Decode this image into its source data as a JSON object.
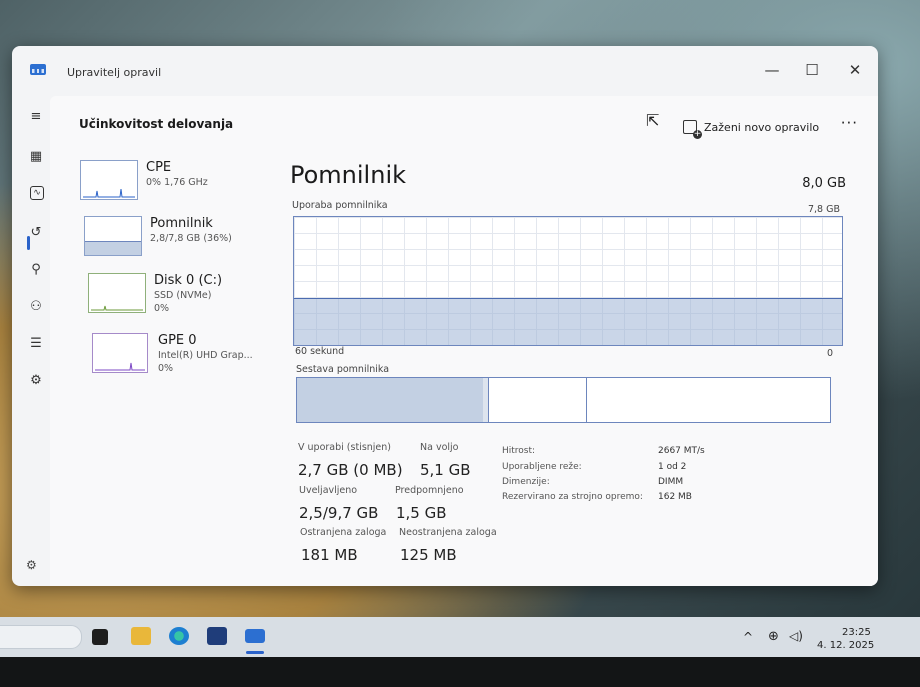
{
  "window": {
    "title": "Upravitelj opravil",
    "controls": {
      "minimize": "—",
      "maximize": "☐",
      "close": "✕"
    }
  },
  "header": {
    "page_title": "Učinkovitost delovanja",
    "run_task_label": "Zaženi novo opravilo",
    "more": "···"
  },
  "nav_icons": [
    "hamburger-icon",
    "processes-icon",
    "performance-icon",
    "app-history-icon",
    "startup-icon",
    "users-icon",
    "details-icon",
    "services-icon"
  ],
  "devices": [
    {
      "name": "CPE",
      "sub": "0% 1,76 GHz",
      "sub2": ""
    },
    {
      "name": "Pomnilnik",
      "sub": "2,8/7,8 GB (36%)",
      "sub2": ""
    },
    {
      "name": "Disk 0 (C:)",
      "sub": "SSD (NVMe)",
      "sub2": "0%"
    },
    {
      "name": "GPE 0",
      "sub": "Intel(R) UHD Grap...",
      "sub2": "0%"
    }
  ],
  "memory": {
    "title": "Pomnilnik",
    "total": "8,0 GB",
    "usage_label": "Uporaba pomnilnika",
    "usage_max": "7,8 GB",
    "time_left": "60 sekund",
    "time_right": "0",
    "usage_fraction": 0.36,
    "composition_label": "Sestava pomnilnika"
  },
  "stats": {
    "in_use_label": "V uporabi (stisnjen)",
    "in_use_value": "2,7 GB (0 MB)",
    "available_label": "Na voljo",
    "available_value": "5,1 GB",
    "committed_label": "Uveljavljeno",
    "committed_value": "2,5/9,7 GB",
    "cached_label": "Predpomnjeno",
    "cached_value": "1,5 GB",
    "paged_label": "Ostranjena zaloga",
    "paged_value": "181 MB",
    "nonpaged_label": "Neostranjena zaloga",
    "nonpaged_value": "125 MB"
  },
  "details": [
    {
      "key": "Hitrost:",
      "value": "2667 MT/s"
    },
    {
      "key": "Uporabljene reže:",
      "value": "1 od 2"
    },
    {
      "key": "Dimenzije:",
      "value": "DIMM"
    },
    {
      "key": "Rezervirano za strojno opremo:",
      "value": "162 MB"
    }
  ],
  "taskbar": {
    "time": "23:25",
    "date": "4. 12. 2025",
    "tray_chevron": "^"
  },
  "colors": {
    "accent": "#2a62c9",
    "graph_fill": "#c3d0e3",
    "graph_line": "#6d86bd"
  }
}
